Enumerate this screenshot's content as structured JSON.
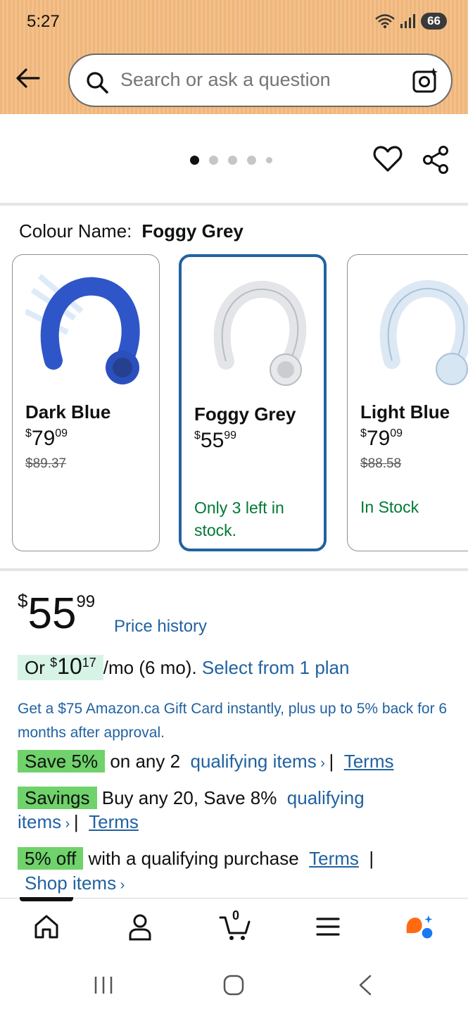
{
  "status_bar": {
    "time": "5:27",
    "battery": "66"
  },
  "search": {
    "placeholder": "Search or ask a question"
  },
  "gallery": {
    "dot_count": 5,
    "active_dot": 1
  },
  "colour": {
    "label": "Colour Name:",
    "selected": "Foggy Grey"
  },
  "variants": [
    {
      "name": "Dark Blue",
      "price_currency": "$",
      "price_dollars": "79",
      "price_cents": "09",
      "old_price": "$89.37",
      "stock": "",
      "color": "#2f56c8"
    },
    {
      "name": "Foggy Grey",
      "price_currency": "$",
      "price_dollars": "55",
      "price_cents": "99",
      "old_price": "",
      "stock": "Only 3 left in stock.",
      "color": "#e6e8ea"
    },
    {
      "name": "Light Blue",
      "price_currency": "$",
      "price_dollars": "79",
      "price_cents": "09",
      "old_price": "$88.58",
      "stock": "In Stock",
      "color": "#dce9f4"
    }
  ],
  "price": {
    "currency": "$",
    "dollars": "55",
    "cents": "99",
    "history_link": "Price history"
  },
  "monthly": {
    "prefix": "Or",
    "currency": "$",
    "dollars": "10",
    "cents": "17",
    "suffix": "/mo (6 mo).",
    "plan_link": "Select from 1 plan"
  },
  "gift_card": "Get a $75 Amazon.ca Gift Card instantly, plus up to 5% back for 6 months after approval.",
  "promos": [
    {
      "tag": "Save 5%",
      "text": "on any 2",
      "link": "qualifying items",
      "terms": "Terms"
    },
    {
      "tag": "Savings",
      "text": "Buy any 20, Save 8%",
      "link_part1": "qualifying",
      "link_part2": "items",
      "terms": "Terms"
    },
    {
      "tag": "5% off",
      "text": "with a qualifying purchase",
      "terms": "Terms",
      "shop_link": "Shop items"
    }
  ],
  "bottom_nav": {
    "cart_count": "0"
  },
  "colors": {
    "link": "#2162a1",
    "stock_green": "#007a34",
    "promo_green": "#6fd26a",
    "selected_border": "#2162a1"
  }
}
